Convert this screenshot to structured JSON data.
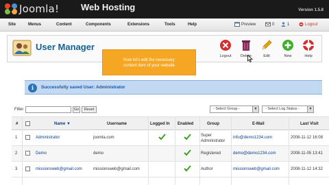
{
  "header": {
    "logo_text": "Joomla!",
    "site_name": "Web Hosting",
    "version": "Version 1.5.8"
  },
  "menu": {
    "items": [
      "Site",
      "Menus",
      "Content",
      "Components",
      "Extensions",
      "Tools",
      "Help"
    ],
    "preview": "Preview",
    "messages": "0",
    "users": "1",
    "logout": "Logout"
  },
  "page": {
    "title": "User Manager",
    "icon": "user-manager-icon"
  },
  "toolbar": {
    "buttons": [
      {
        "label": "Logout",
        "icon": "logout-icon",
        "color": "#d42f2f"
      },
      {
        "label": "Delete",
        "icon": "trash-icon",
        "color": "#8a2c5a"
      },
      {
        "label": "Edit",
        "icon": "pencil-icon",
        "color": "#e7a400"
      },
      {
        "label": "New",
        "icon": "plus-icon",
        "color": "#3fae29"
      },
      {
        "label": "Help",
        "icon": "lifebuoy-icon",
        "color": "#d42f2f"
      }
    ]
  },
  "tooltip": {
    "line1": "Now let's edit the necessary",
    "line2": "content item of your website"
  },
  "message": {
    "text": "Successfully saved User: Administrator"
  },
  "filter": {
    "label": "Filter",
    "value": "",
    "go": "Go",
    "reset": "Reset",
    "group_select": "- Select Group -",
    "status_select": "- Select Log Status -"
  },
  "table": {
    "headers": {
      "num": "#",
      "name": "Name",
      "username": "Username",
      "logged_in": "Logged In",
      "enabled": "Enabled",
      "group": "Group",
      "email": "E-Mail",
      "last_visit": "Last Visit"
    },
    "rows": [
      {
        "num": "1",
        "name": "Administrator",
        "username": "joomla.com",
        "group1": "Super",
        "group2": "Administrator",
        "email": "info@demo1234.com",
        "last_visit": "2008-11-12 16:08"
      },
      {
        "num": "2",
        "name": "Demo",
        "username": "demo",
        "group1": "Registered",
        "group2": "",
        "email": "demo@demo1234.com",
        "last_visit": "2008-11-05 13:41"
      },
      {
        "num": "3",
        "name": "missionsweb@gmail.com",
        "username": "missionsweb@gmail.com",
        "group1": "Author",
        "group2": "",
        "email": "missionsweb@gmail.com",
        "last_visit": "2008-11-12 14:32"
      }
    ]
  },
  "colors": {
    "accent": "#146295",
    "tooltip": "#f5a623",
    "message_bg": "#c3d9f1",
    "link": "#0b3c8c",
    "check": "#3aa11d"
  }
}
